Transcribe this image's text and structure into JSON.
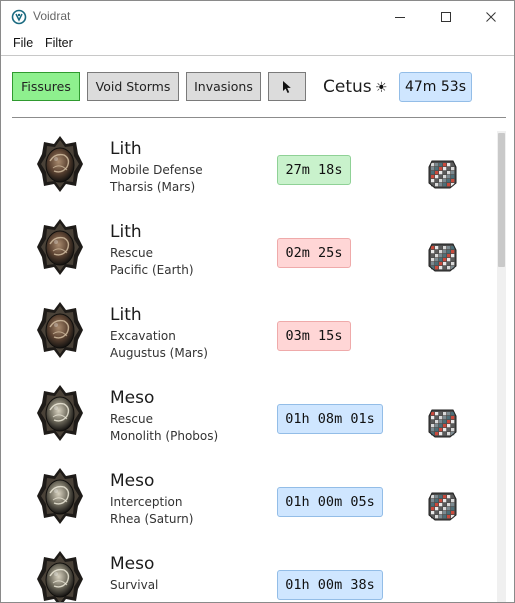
{
  "window": {
    "title": "Voidrat"
  },
  "menu": {
    "items": [
      "File",
      "Filter"
    ]
  },
  "toolbar": {
    "tabs": [
      "Fissures",
      "Void Storms",
      "Invasions"
    ],
    "active_tab": "Fissures",
    "cycle": {
      "location": "Cetus",
      "state_icon": "sun-icon",
      "time": "47m 53s"
    }
  },
  "fissures": [
    {
      "tier": "Lith",
      "mission": "Mobile Defense",
      "node": "Tharsis (Mars)",
      "time": "27m 18s",
      "status": "green",
      "steel_path": true
    },
    {
      "tier": "Lith",
      "mission": "Rescue",
      "node": "Pacific (Earth)",
      "time": "02m 25s",
      "status": "red",
      "steel_path": true
    },
    {
      "tier": "Lith",
      "mission": "Excavation",
      "node": "Augustus (Mars)",
      "time": "03m 15s",
      "status": "red",
      "steel_path": false
    },
    {
      "tier": "Meso",
      "mission": "Rescue",
      "node": "Monolith (Phobos)",
      "time": "01h 08m 01s",
      "status": "blue",
      "steel_path": true
    },
    {
      "tier": "Meso",
      "mission": "Interception",
      "node": "Rhea (Saturn)",
      "time": "01h 00m 05s",
      "status": "blue",
      "steel_path": true
    },
    {
      "tier": "Meso",
      "mission": "Survival",
      "node": "",
      "time": "01h 00m 38s",
      "status": "blue",
      "steel_path": false
    }
  ],
  "colors": {
    "active_tab": "#8ef08e",
    "timer_green": "#c9f2cc",
    "timer_red": "#ffd6d6",
    "timer_blue": "#cfe6ff"
  }
}
